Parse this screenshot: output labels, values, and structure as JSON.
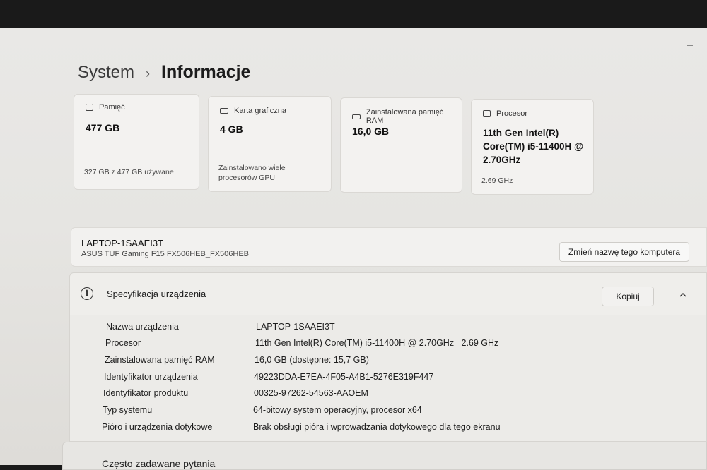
{
  "breadcrumb": {
    "parent": "System",
    "separator": "›",
    "current": "Informacje"
  },
  "cards": [
    {
      "label": "Pamięć",
      "icon": "storage-icon",
      "value": "477 GB",
      "sub": "327 GB z 477 GB używane"
    },
    {
      "label": "Karta graficzna",
      "icon": "gpu-icon",
      "value": "4 GB",
      "sub": "Zainstalowano wiele\nprocesorów GPU"
    },
    {
      "label": "Zainstalowana pamięć RAM",
      "icon": "ram-icon",
      "value": "16,0 GB",
      "sub": ""
    },
    {
      "label": "Procesor",
      "icon": "cpu-icon",
      "value": "11th Gen Intel(R)\nCore(TM) i5-11400H @\n2.70GHz",
      "sub": "2.69 GHz"
    }
  ],
  "device": {
    "name": "LAPTOP-1SAAEI3T",
    "model": "ASUS TUF Gaming F15 FX506HEB_FX506HEB",
    "rename_label": "Zmień nazwę tego komputera"
  },
  "spec": {
    "title": "Specyfikacja urządzenia",
    "copy_label": "Kopiuj",
    "rows": [
      {
        "label": "Nazwa urządzenia",
        "value": "LAPTOP-1SAAEI3T"
      },
      {
        "label": "Procesor",
        "value": "11th Gen Intel(R) Core(TM) i5-11400H @ 2.70GHz   2.69 GHz"
      },
      {
        "label": "Zainstalowana pamięć RAM",
        "value": "16,0 GB (dostępne: 15,7 GB)"
      },
      {
        "label": "Identyfikator urządzenia",
        "value": "49223DDA-E7EA-4F05-A4B1-5276E319F447"
      },
      {
        "label": "Identyfikator produktu",
        "value": "00325-97262-54563-AAOEM"
      },
      {
        "label": "Typ systemu",
        "value": "64-bitowy system operacyjny, procesor x64"
      },
      {
        "label": "Pióro i urządzenia dotykowe",
        "value": "Brak obsługi pióra i wprowadzania dotykowego dla tego ekranu"
      }
    ]
  },
  "faq": {
    "title": "Często zadawane pytania"
  }
}
